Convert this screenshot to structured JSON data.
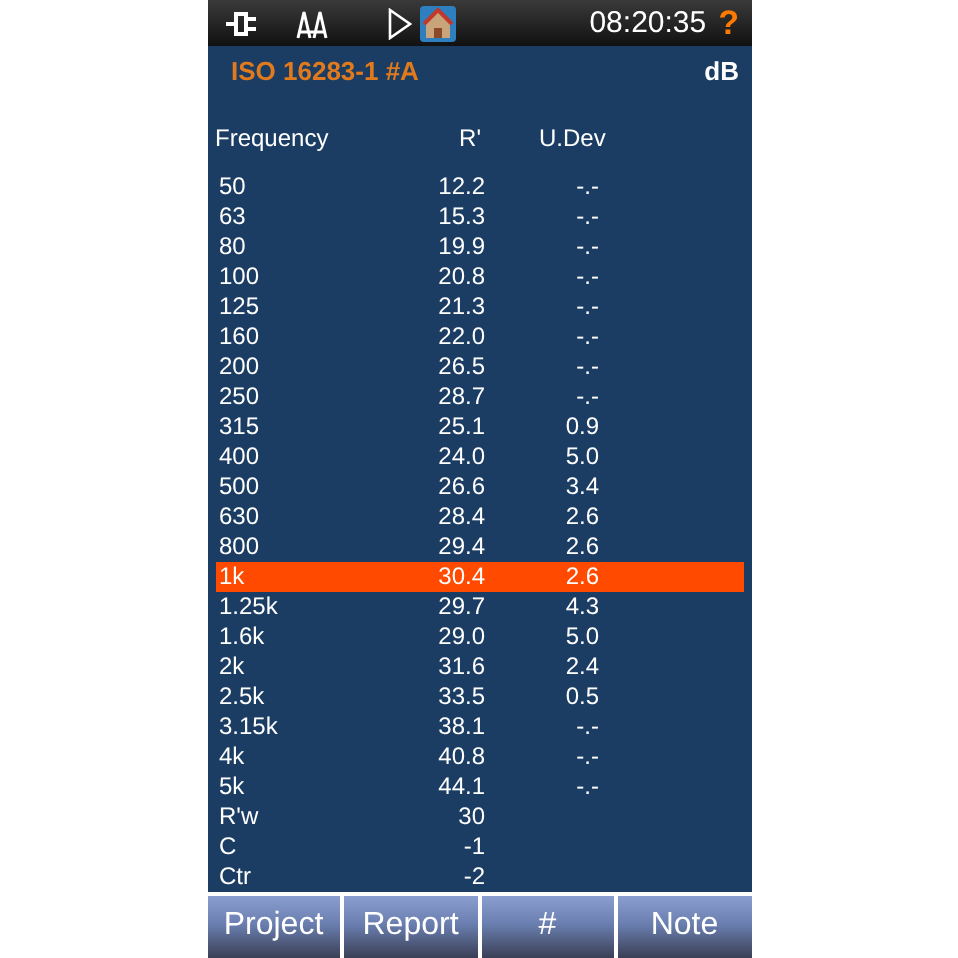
{
  "status_bar": {
    "time": "08:20:35",
    "help": "?"
  },
  "title": {
    "standard": "ISO 16283-1 #A",
    "unit": "dB"
  },
  "table": {
    "columns": [
      "Frequency",
      "R'",
      "U.Dev"
    ],
    "rows": [
      {
        "frequency": "50",
        "r": "12.2",
        "udev": "-.-",
        "selected": false
      },
      {
        "frequency": "63",
        "r": "15.3",
        "udev": "-.-",
        "selected": false
      },
      {
        "frequency": "80",
        "r": "19.9",
        "udev": "-.-",
        "selected": false
      },
      {
        "frequency": "100",
        "r": "20.8",
        "udev": "-.-",
        "selected": false
      },
      {
        "frequency": "125",
        "r": "21.3",
        "udev": "-.-",
        "selected": false
      },
      {
        "frequency": "160",
        "r": "22.0",
        "udev": "-.-",
        "selected": false
      },
      {
        "frequency": "200",
        "r": "26.5",
        "udev": "-.-",
        "selected": false
      },
      {
        "frequency": "250",
        "r": "28.7",
        "udev": "-.-",
        "selected": false
      },
      {
        "frequency": "315",
        "r": "25.1",
        "udev": "0.9",
        "selected": false
      },
      {
        "frequency": "400",
        "r": "24.0",
        "udev": "5.0",
        "selected": false
      },
      {
        "frequency": "500",
        "r": "26.6",
        "udev": "3.4",
        "selected": false
      },
      {
        "frequency": "630",
        "r": "28.4",
        "udev": "2.6",
        "selected": false
      },
      {
        "frequency": "800",
        "r": "29.4",
        "udev": "2.6",
        "selected": false
      },
      {
        "frequency": "1k",
        "r": "30.4",
        "udev": "2.6",
        "selected": true
      },
      {
        "frequency": "1.25k",
        "r": "29.7",
        "udev": "4.3",
        "selected": false
      },
      {
        "frequency": "1.6k",
        "r": "29.0",
        "udev": "5.0",
        "selected": false
      },
      {
        "frequency": "2k",
        "r": "31.6",
        "udev": "2.4",
        "selected": false
      },
      {
        "frequency": "2.5k",
        "r": "33.5",
        "udev": "0.5",
        "selected": false
      },
      {
        "frequency": "3.15k",
        "r": "38.1",
        "udev": "-.-",
        "selected": false
      },
      {
        "frequency": "4k",
        "r": "40.8",
        "udev": "-.-",
        "selected": false
      },
      {
        "frequency": "5k",
        "r": "44.1",
        "udev": "-.-",
        "selected": false
      },
      {
        "frequency": "R'w",
        "r": "30",
        "selected": false
      },
      {
        "frequency": "C",
        "r": "-1",
        "selected": false
      },
      {
        "frequency": "Ctr",
        "r": "-2",
        "selected": false
      }
    ]
  },
  "buttons": [
    "Project",
    "Report",
    "#",
    "Note"
  ]
}
